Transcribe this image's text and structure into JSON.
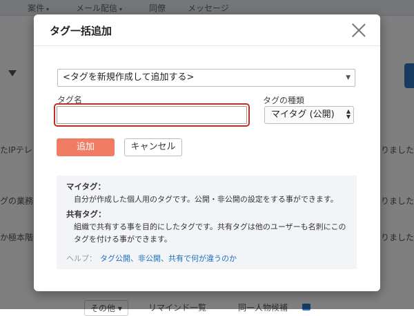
{
  "background": {
    "nav": [
      {
        "label": "案件",
        "has_caret": true
      },
      {
        "label": "メール配信",
        "has_caret": true
      },
      {
        "label": "同僚",
        "has_caret": false
      },
      {
        "label": "メッセージ",
        "has_caret": false
      }
    ],
    "caret": "▾",
    "filter_icon": "filter-icon",
    "left_fragments": [
      "たIPテレ",
      "グの業務",
      "か極本階"
    ],
    "right_fragments": [
      "りました",
      "りました",
      "りました"
    ],
    "bottom_buttons": [
      "その他 ▾",
      "リマインド一覧",
      "同一人物候補"
    ],
    "accent": "#2f74c0"
  },
  "modal": {
    "title": "タグ一括追加",
    "tag_select": {
      "selected": "<タグを新規作成して追加する>"
    },
    "tag_name": {
      "label": "タグ名",
      "value": "",
      "placeholder": ""
    },
    "tag_type": {
      "label": "タグの種類",
      "selected": "マイタグ (公開)"
    },
    "add_button": "追加",
    "cancel_button": "キャンセル",
    "info": {
      "my_tag_heading": "マイタグ：",
      "my_tag_desc": "自分が作成した個人用のタグです。公開・非公開の設定をする事ができます。",
      "shared_tag_heading": "共有タグ：",
      "shared_tag_desc_1": "組織で共有する事を目的にしたタグです。共有タグは他のユーザーも名刺にこの",
      "shared_tag_desc_2": "タグを付ける事ができます。",
      "help_label": "ヘルプ：",
      "help_link": "タグ公開、非公開、共有で何が違うのか"
    },
    "colors": {
      "add_button": "#f07d63",
      "focus_outline": "#c0282a",
      "link": "#1f6fbf"
    }
  }
}
